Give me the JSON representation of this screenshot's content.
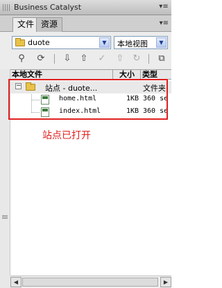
{
  "panel": {
    "title": "Business Catalyst",
    "menu_glyph": "▾≡"
  },
  "tabs": [
    {
      "label": "文件",
      "active": true
    },
    {
      "label": "资源",
      "active": false
    }
  ],
  "toolbar": {
    "site_select": {
      "value": "duote"
    },
    "view_select": {
      "value": "本地视图"
    }
  },
  "columns": {
    "name": "本地文件",
    "size": "大小",
    "type": "类型"
  },
  "tree": {
    "site": {
      "expander": "−",
      "name": "站点 - duote...",
      "type": "文件夹"
    },
    "files": [
      {
        "name": "home.html",
        "size": "1KB",
        "type": "360 se"
      },
      {
        "name": "index.html",
        "size": "1KB",
        "type": "360 se"
      }
    ]
  },
  "annotation": {
    "text": "站点已打开",
    "color": "#e02020"
  },
  "icons": {
    "connect": "connect-icon",
    "refresh": "refresh-icon",
    "get": "get-file-icon",
    "put": "put-file-icon",
    "checkout": "check-out-icon",
    "checkin": "check-in-icon",
    "sync": "synchronize-icon",
    "expand": "expand-panel-icon"
  }
}
